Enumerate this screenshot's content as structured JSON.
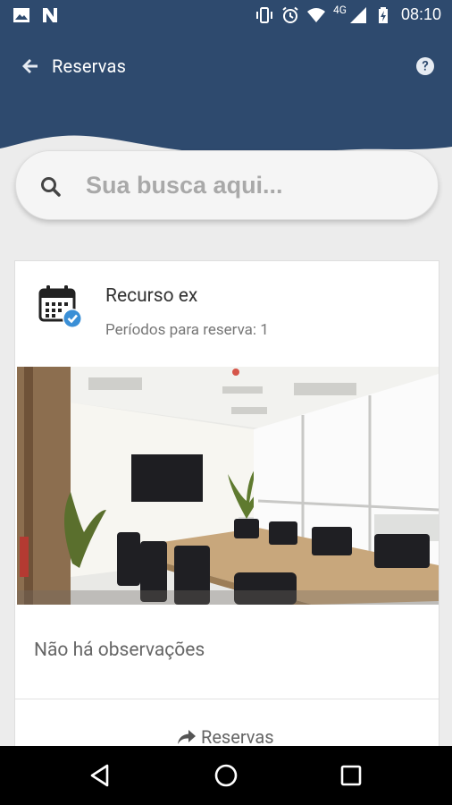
{
  "status_bar": {
    "time": "08:10",
    "network": "4G",
    "icons": [
      "image-icon",
      "n-app-icon",
      "vibrate-icon",
      "alarm-icon",
      "wifi-icon",
      "signal-icon",
      "battery-charging-icon"
    ]
  },
  "header": {
    "title": "Reservas",
    "back_icon": "arrow-left-icon",
    "help_icon": "help-circle-icon",
    "color": "#2e4a6e"
  },
  "search": {
    "placeholder": "Sua busca aqui..."
  },
  "card": {
    "icon": "calendar-check-icon",
    "title": "Recurso ex",
    "periods_text": "Períodos para reserva: 1",
    "observations": "Não há observações",
    "action_label": "Reservas",
    "action_icon": "share-arrow-icon",
    "accent": "#3a8fd6"
  },
  "nav_bar": {
    "buttons": [
      "back",
      "home",
      "recents"
    ]
  }
}
